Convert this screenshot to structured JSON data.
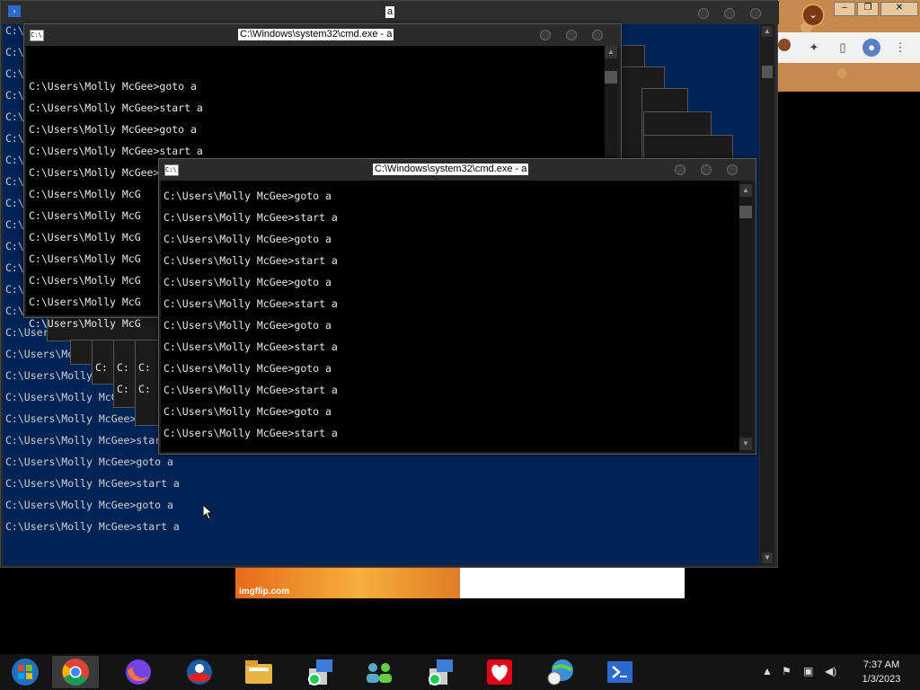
{
  "powershell": {
    "title": "a",
    "lines": [
      "C:\\",
      "C:\\",
      "C:\\",
      "C:\\",
      "C:\\",
      "C:\\",
      "C:\\",
      "C:\\",
      "C:\\",
      "C:\\",
      "C:\\",
      "C:\\",
      "C:\\",
      "C:\\Users\\",
      "C:\\Users\\M",
      "C:\\Users\\Molly",
      "C:\\Users\\Molly Mc",
      "C:\\Users\\Molly McGee",
      "C:\\Users\\Molly McGee>got",
      "C:\\Users\\Molly McGee>start a",
      "C:\\Users\\Molly McGee>goto a",
      "C:\\Users\\Molly McGee>start a",
      "C:\\Users\\Molly McGee>goto a",
      "C:\\Users\\Molly McGee>start a"
    ]
  },
  "cmd1": {
    "title": "C:\\Windows\\system32\\cmd.exe - a",
    "lines": [
      "C:\\Users\\Molly McGee>goto a",
      "C:\\Users\\Molly McGee>start a",
      "C:\\Users\\Molly McGee>goto a",
      "C:\\Users\\Molly McGee>start a",
      "C:\\Users\\Molly McGee>goto a",
      "C:\\Users\\Molly McG",
      "C:\\Users\\Molly McG",
      "C:\\Users\\Molly McG",
      "C:\\Users\\Molly McG",
      "C:\\Users\\Molly McG",
      "C:\\Users\\Molly McG",
      "C:\\Users\\Molly McG"
    ]
  },
  "cmd2": {
    "title": "C:\\Windows\\system32\\cmd.exe - a",
    "lines": [
      "C:\\Users\\Molly McGee>goto a",
      "C:\\Users\\Molly McGee>start a",
      "C:\\Users\\Molly McGee>goto a",
      "C:\\Users\\Molly McGee>start a",
      "C:\\Users\\Molly McGee>goto a",
      "C:\\Users\\Molly McGee>start a",
      "C:\\Users\\Molly McGee>goto a",
      "C:\\Users\\Molly McGee>start a",
      "C:\\Users\\Molly McGee>goto a",
      "C:\\Users\\Molly McGee>start a",
      "C:\\Users\\Molly McGee>goto a",
      "C:\\Users\\Molly McGee>start a"
    ]
  },
  "stacked_prompt": "C:",
  "meme_watermark": "imgflip.com",
  "taskbar": {
    "time": "7:37 AM",
    "date": "1/3/2023",
    "apps": [
      "start-orb",
      "chrome",
      "firefox",
      "obama-campaign",
      "file-explorer",
      "install-package",
      "people-network",
      "install-package-2",
      "wall-ice-cream",
      "globe-clock",
      "powershell"
    ]
  },
  "colors": {
    "powershell_bg": "#012456",
    "cmd_bg": "#000000",
    "taskbar_bg": "#141414"
  }
}
